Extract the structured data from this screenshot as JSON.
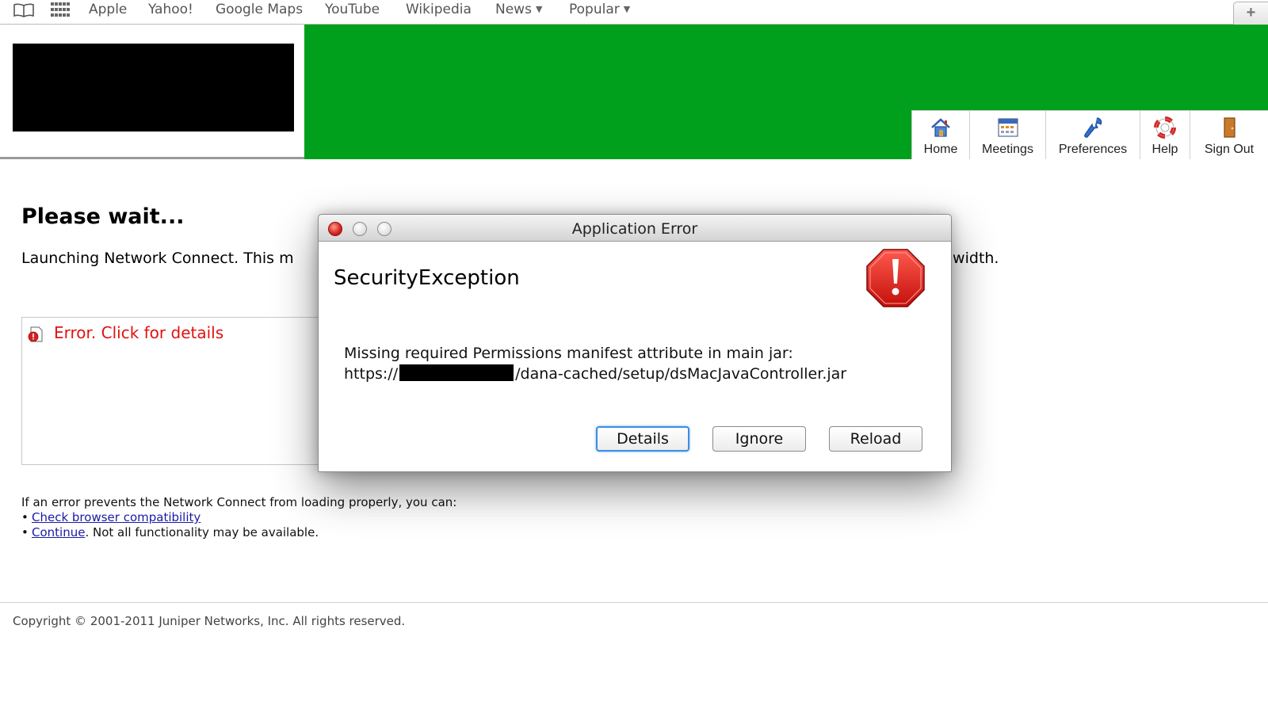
{
  "bookmarks": {
    "items": [
      "Apple",
      "Yahoo!",
      "Google Maps",
      "YouTube",
      "Wikipedia",
      "News",
      "Popular"
    ],
    "new_tab": "+"
  },
  "nav": {
    "items": [
      {
        "label": "Home",
        "icon": "home-icon"
      },
      {
        "label": "Meetings",
        "icon": "calendar-icon"
      },
      {
        "label": "Preferences",
        "icon": "wrench-icon"
      },
      {
        "label": "Help",
        "icon": "lifebuoy-icon"
      },
      {
        "label": "Sign Out",
        "icon": "door-icon"
      }
    ]
  },
  "main": {
    "title": "Please wait...",
    "launch_text": "Launching Network Connect. This m",
    "launch_text_tail": "dwidth.",
    "applet_error": "Error. Click for details",
    "help_intro": "If an error prevents the Network Connect from loading properly, you can:",
    "help_link1": "Check browser compatibility",
    "help_link2": "Continue",
    "help_link2_suffix": ". Not all functionality may be available.",
    "bullet": "•"
  },
  "footer": {
    "copyright": "Copyright © 2001-2011 Juniper Networks, Inc. All rights reserved."
  },
  "dialog": {
    "title": "Application Error",
    "exception": "SecurityException",
    "message_line1": "Missing required Permissions manifest attribute in main jar:",
    "message_url_prefix": "https://",
    "message_url_suffix": "/dana-cached/setup/dsMacJavaController.jar",
    "buttons": {
      "details": "Details",
      "ignore": "Ignore",
      "reload": "Reload"
    }
  },
  "colors": {
    "banner_green": "#00a01c",
    "error_red": "#e0120f",
    "link_blue": "#1a1aa6",
    "focus_blue": "#3d8ce6"
  }
}
